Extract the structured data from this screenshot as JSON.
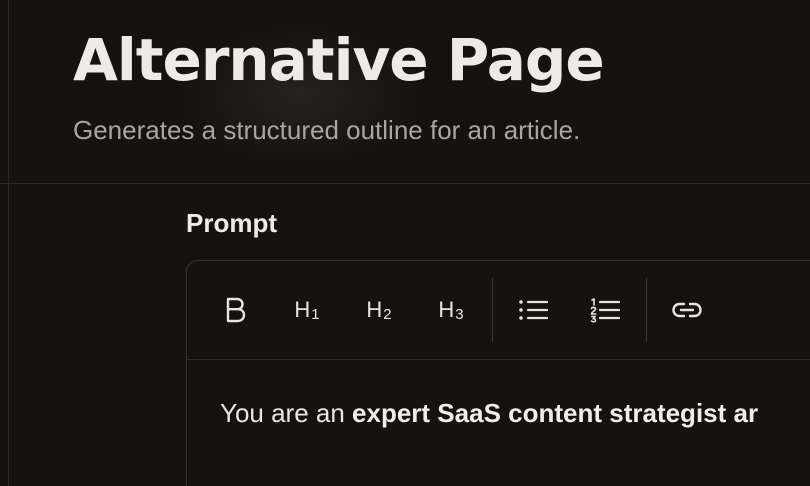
{
  "header": {
    "title": "Alternative Page",
    "subtitle": "Generates a structured outline for an article."
  },
  "prompt": {
    "label": "Prompt",
    "toolbar": {
      "h1_label": "H",
      "h1_sub": "1",
      "h2_label": "H",
      "h2_sub": "2",
      "h3_label": "H",
      "h3_sub": "3"
    },
    "content": {
      "prefix": "You are an ",
      "bold": "expert SaaS content strategist ar"
    }
  }
}
